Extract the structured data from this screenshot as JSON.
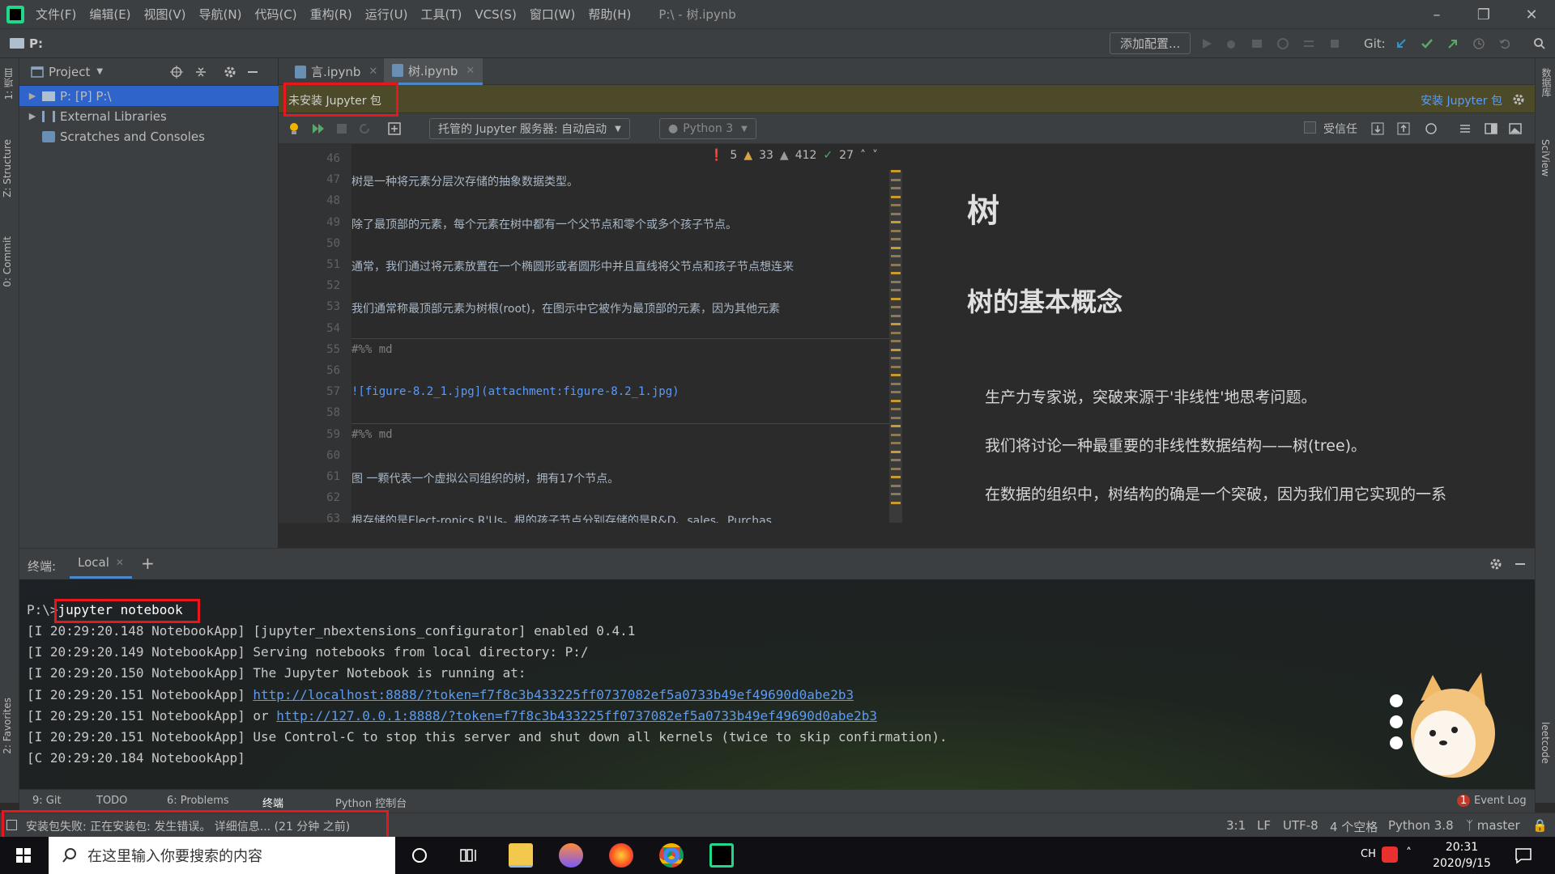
{
  "app": {
    "title": "P:\\ - 树.ipynb",
    "menu": [
      "文件(F)",
      "编辑(E)",
      "视图(V)",
      "导航(N)",
      "代码(C)",
      "重构(R)",
      "运行(U)",
      "工具(T)",
      "VCS(S)",
      "窗口(W)",
      "帮助(H)"
    ]
  },
  "navbar": {
    "path": "P:",
    "add_config": "添加配置...",
    "git_label": "Git:"
  },
  "left_strip": [
    "1: 项目",
    "Z: Structure",
    "0: Commit",
    "2: Favorites"
  ],
  "right_strip": [
    "数据库",
    "SciView",
    "leetcode"
  ],
  "project": {
    "title": "Project",
    "tree": [
      {
        "label": "P: [P]  P:\\",
        "expandable": true,
        "selected": true
      },
      {
        "label": "External Libraries",
        "expandable": true,
        "selected": false
      },
      {
        "label": "Scratches and Consoles",
        "expandable": false,
        "selected": false
      }
    ]
  },
  "editor": {
    "tabs": [
      {
        "label": "言.ipynb",
        "active": false
      },
      {
        "label": "树.ipynb",
        "active": true
      }
    ],
    "banner": "未安装 Jupyter 包",
    "install_link": "安装 Jupyter 包",
    "server_select": "托管的 Jupyter 服务器: 自动启动",
    "kernel_select": "Python 3",
    "trusted_label": "受信任",
    "inspection": {
      "errors": "5",
      "warnings": "33",
      "weak": "412",
      "ok": "27"
    },
    "line_numbers": [
      "46",
      "47",
      "48",
      "49",
      "50",
      "51",
      "52",
      "53",
      "54",
      "55",
      "56",
      "57",
      "58",
      "59",
      "60",
      "61",
      "62",
      "63"
    ],
    "code_lines": [
      "",
      "    树是一种将元素分层次存储的抽象数据类型。",
      "",
      "    除了最顶部的元素，每个元素在树中都有一个父节点和零个或多个孩子节点。",
      "",
      "    通常，我们通过将元素放置在一个椭圆形或者圆形中并且直线将父节点和孩子节点想连来",
      "",
      "    我们通常称最顶部元素为树根(root)，在图示中它被作为最顶部的元素，因为其他元素",
      "",
      "#%% md",
      "",
      "![figure-8.2_1.jpg](attachment:figure-8.2_1.jpg)",
      "",
      "#%% md",
      "",
      "    图 一颗代表一个虚拟公司组织的树，拥有17个节点。",
      "",
      "    根存储的是Elect-ronics R'Us。根的孩子节点分别存储的是R&D、sales、Purchas"
    ]
  },
  "preview": {
    "h1": "树",
    "h2": "树的基本概念",
    "paragraphs": [
      "生产力专家说，突破来源于'非线性'地思考问题。",
      "我们将讨论一种最重要的非线性数据结构——树(tree)。",
      "在数据的组织中，树结构的确是一个突破，因为我们用它实现的一系"
    ]
  },
  "terminal": {
    "label": "终端:",
    "tab": "Local",
    "prompt": "P:\\>",
    "command": "jupyter notebook",
    "lines": [
      {
        "text": "[I 20:29:20.148 NotebookApp] [jupyter_nbextensions_configurator] enabled 0.4.1",
        "link": ""
      },
      {
        "text": "[I 20:29:20.149 NotebookApp] Serving notebooks from local directory: P:/",
        "link": ""
      },
      {
        "text": "[I 20:29:20.150 NotebookApp] The Jupyter Notebook is running at:",
        "link": ""
      },
      {
        "text": "[I 20:29:20.151 NotebookApp] ",
        "link": "http://localhost:8888/?token=f7f8c3b433225ff0737082ef5a0733b49ef49690d0abe2b3"
      },
      {
        "text": "[I 20:29:20.151 NotebookApp]  or ",
        "link": "http://127.0.0.1:8888/?token=f7f8c3b433225ff0737082ef5a0733b49ef49690d0abe2b3"
      },
      {
        "text": "[I 20:29:20.151 NotebookApp] Use Control-C to stop this server and shut down all kernels (twice to skip confirmation).",
        "link": ""
      },
      {
        "text": "[C 20:29:20.184 NotebookApp]",
        "link": ""
      }
    ]
  },
  "toolwindows": [
    "9: Git",
    "TODO",
    "6: Problems",
    "终端",
    "Python 控制台"
  ],
  "event_log": "Event Log",
  "event_count": "1",
  "status": {
    "message": "安装包失败: 正在安装包: 发生错误。 详细信息... (21 分钟 之前)",
    "position": "3:1",
    "line_sep": "LF",
    "encoding": "UTF-8",
    "indent": "4 个空格",
    "interpreter": "Python 3.8",
    "branch": "master"
  },
  "taskbar": {
    "search_placeholder": "在这里输入你要搜索的内容",
    "ime": "CH",
    "time": "20:31",
    "date": "2020/9/15"
  }
}
